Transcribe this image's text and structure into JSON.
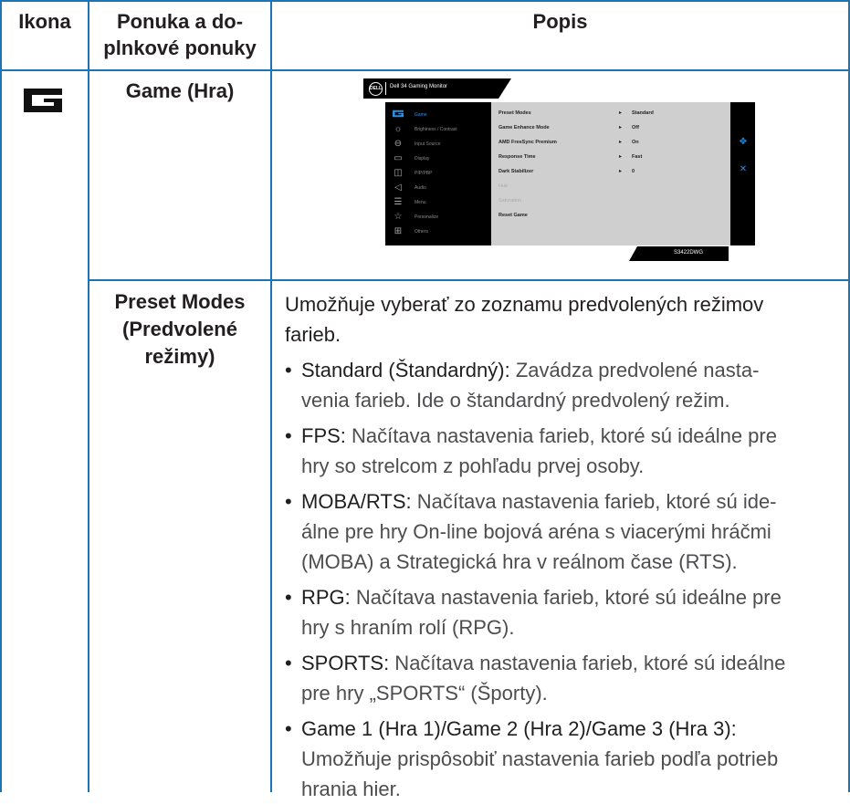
{
  "header": {
    "col1": "Ikona",
    "col2": "Ponuka a do-\nplnkové ponuky",
    "col3": "Popis"
  },
  "row1": {
    "icon_name": "game-g-icon",
    "menu": "Game (Hra)"
  },
  "osd": {
    "title": "Dell 34 Gaming Monitor",
    "logo": "DELL",
    "model": "S3422DWG",
    "menu_items": [
      {
        "label": "Game",
        "icon": "game-icon"
      },
      {
        "label": "Brightness / Contrast",
        "icon": "brightness-icon"
      },
      {
        "label": "Input Source",
        "icon": "input-source-icon"
      },
      {
        "label": "Display",
        "icon": "display-icon"
      },
      {
        "label": "PIP/PBP",
        "icon": "pip-pbp-icon"
      },
      {
        "label": "Audio",
        "icon": "audio-icon"
      },
      {
        "label": "Menu",
        "icon": "menu-icon"
      },
      {
        "label": "Personalize",
        "icon": "star-icon"
      },
      {
        "label": "Others",
        "icon": "others-icon"
      }
    ],
    "settings": [
      {
        "key": "Preset Modes",
        "value": "Standard"
      },
      {
        "key": "Game Enhance Mode",
        "value": "Off"
      },
      {
        "key": "AMD FreeSync Premium",
        "value": "On"
      },
      {
        "key": "Response Time",
        "value": "Fast"
      },
      {
        "key": "Dark Stabilizer",
        "value": "0"
      },
      {
        "key": "Hue",
        "value": ""
      },
      {
        "key": "Saturation",
        "value": ""
      },
      {
        "key": "Reset Game",
        "value": ""
      }
    ],
    "accent": "#2b8ee0"
  },
  "row2": {
    "menu": "Preset Modes\n(Predvolené\nrežimy)",
    "intro": "Umožňuje vyberať zo zoznamu predvolených režimov\nfarieb.",
    "bullets": [
      {
        "term": "Standard (Štandardný):",
        "text": " Zavádza predvolené nasta-\nvenia farieb. Ide o štandardný predvolený režim."
      },
      {
        "term": "FPS:",
        "text": " Načítava nastavenia farieb, ktoré sú ideálne pre\nhry so strelcom z pohľadu prvej osoby."
      },
      {
        "term": "MOBA/RTS:",
        "text": " Načítava nastavenia farieb, ktoré sú ide-\nálne pre hry On-line bojová aréna s viacerými hráčmi\n(MOBA) a Strategická hra v reálnom čase (RTS)."
      },
      {
        "term": "RPG:",
        "text": " Načítava nastavenia farieb, ktoré sú ideálne pre\nhry s hraním rolí (RPG)."
      },
      {
        "term": "SPORTS:",
        "text": " Načítava nastavenia farieb, ktoré sú ideálne\npre hry „SPORTS“ (Športy)."
      },
      {
        "term": "Game 1 (Hra 1)/Game 2 (Hra 2)/Game 3 (Hra 3):",
        "text": "\nUmožňuje prispôsobiť nastavenia farieb podľa potrieb\nhrania hier."
      }
    ]
  },
  "colors": {
    "rule": "#1a74b5",
    "text": "#231f20",
    "osd_panel": "#cfcfcf"
  }
}
